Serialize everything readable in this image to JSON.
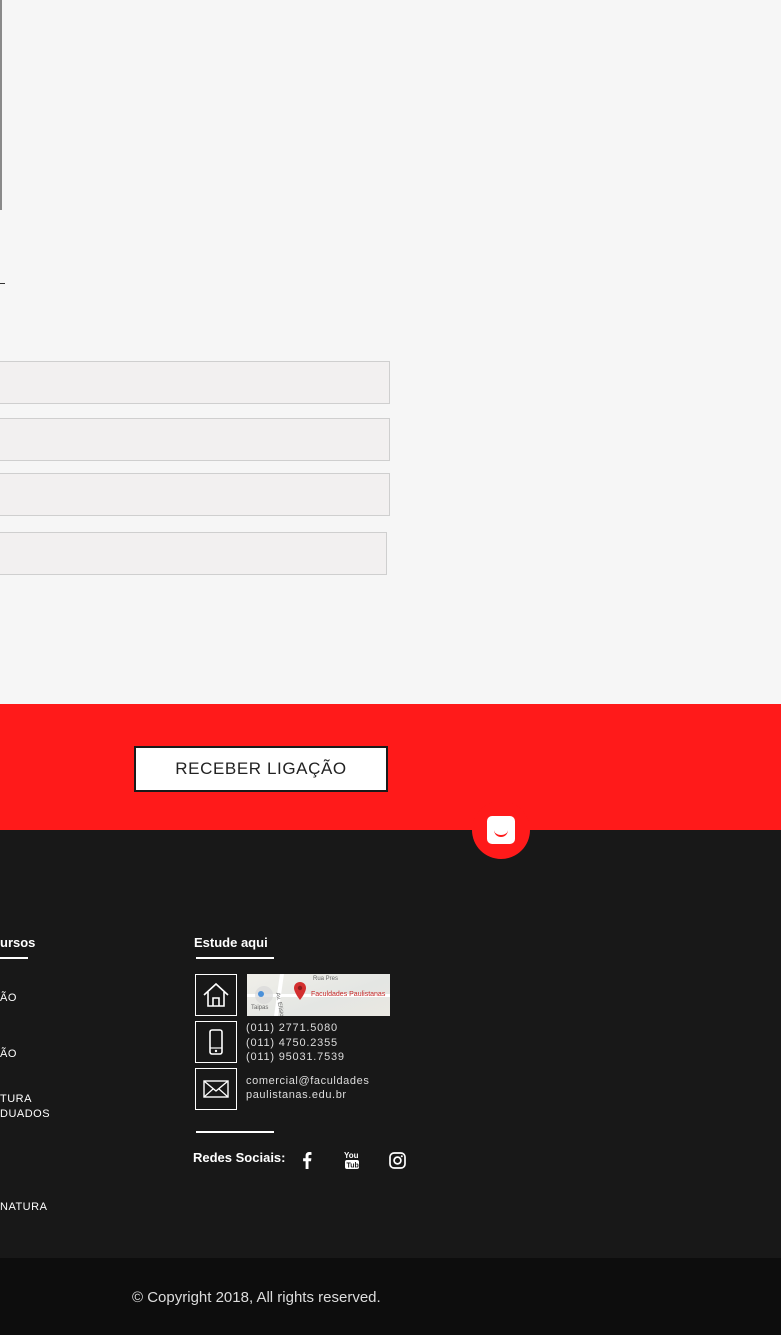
{
  "form": {
    "field1_placeholder": "",
    "field2_placeholder": "",
    "field3_placeholder": "",
    "field4_placeholder": ""
  },
  "cta": {
    "button_label": "RECEBER LIGAÇÃO"
  },
  "footer": {
    "courses_title": "ursos",
    "courses": [
      {
        "label": "ÃO"
      },
      {
        "label": "ÃO"
      },
      {
        "label": "TURA\nDUADOS"
      },
      {
        "label": "NATURA"
      }
    ],
    "study_title": "Estude aqui",
    "map_label": "Faculdades Paulistanas",
    "map_street": "Rua Pres",
    "map_district": "Taipas",
    "map_avenue": "Av. Elísio T",
    "phones": [
      "(011) 2771.5080",
      "(011) 4750.2355",
      "(011) 95031.7539"
    ],
    "email_line1": "comercial@faculdades",
    "email_line2": "paulistanas.edu.br",
    "social_label": "Redes Sociais:",
    "icons": {
      "home": "home-icon",
      "phone": "smartphone-icon",
      "mail": "mail-icon",
      "facebook": "facebook-icon",
      "youtube": "youtube-icon",
      "instagram": "instagram-icon",
      "chat": "chat-icon"
    }
  },
  "bottom": {
    "copyright": "© Copyright 2018, All rights reserved."
  },
  "colors": {
    "accent": "#ff1a1a",
    "footer_bg": "#181818",
    "bottom_bg": "#0d0d0d"
  }
}
